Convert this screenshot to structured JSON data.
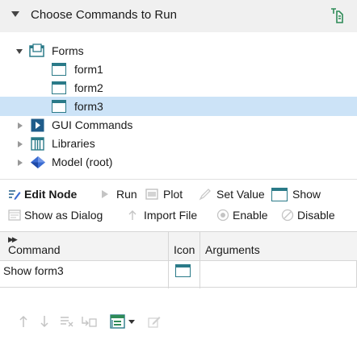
{
  "panel": {
    "title": "Choose Commands to Run"
  },
  "tree": {
    "forms": {
      "label": "Forms",
      "children": [
        "form1",
        "form2",
        "form3"
      ]
    },
    "gui_commands": {
      "label": "GUI Commands"
    },
    "libraries": {
      "label": "Libraries"
    },
    "model": {
      "label": "Model (root)"
    },
    "selected": "form3"
  },
  "toolbar": {
    "edit_node": "Edit Node",
    "run": "Run",
    "plot": "Plot",
    "set_value": "Set Value",
    "show": "Show",
    "show_as_dialog": "Show as Dialog",
    "import_file": "Import File",
    "enable": "Enable",
    "disable": "Disable"
  },
  "table": {
    "columns": [
      "Command",
      "Icon",
      "Arguments"
    ],
    "rows": [
      {
        "command": "Show form3",
        "icon": "form-icon",
        "arguments": ""
      }
    ]
  },
  "bottom_toolbar": {
    "icons": [
      "move-up-icon",
      "move-down-icon",
      "delete-icon",
      "insert-icon",
      "add-command-icon",
      "dropdown-icon",
      "edit-icon"
    ]
  },
  "colors": {
    "selection": "#cce3f7",
    "form_icon": "#2a7a88",
    "gui_icon": "#1f5c8a",
    "model_icon": "#3a6bd1"
  }
}
